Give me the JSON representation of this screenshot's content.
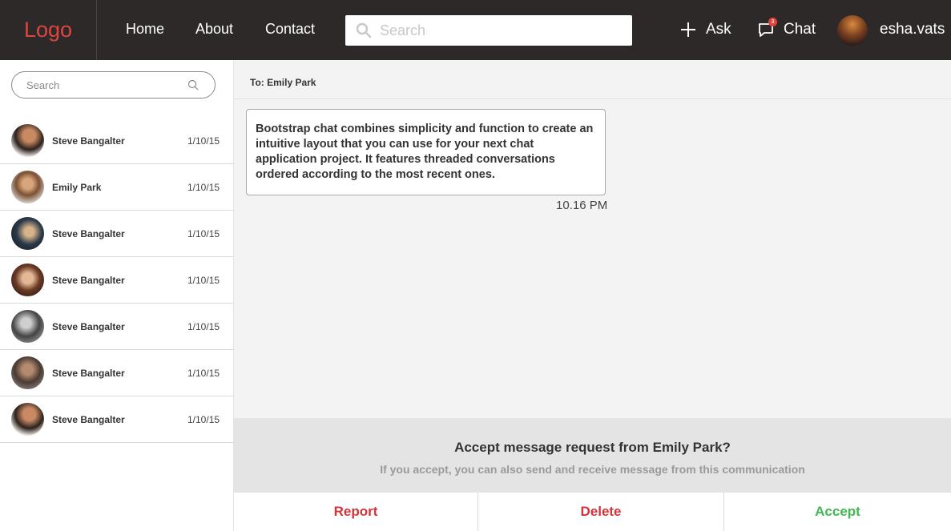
{
  "nav": {
    "logo": "Logo",
    "links": [
      "Home",
      "About",
      "Contact"
    ],
    "search_placeholder": "Search",
    "ask_label": "Ask",
    "chat_label": "Chat",
    "chat_badge": "3",
    "username": "esha.vats",
    "accent_color": "#e0443f"
  },
  "sidebar": {
    "search_placeholder": "Search",
    "contacts": [
      {
        "name": "Steve Bangalter",
        "date": "1/10/15"
      },
      {
        "name": "Emily Park",
        "date": "1/10/15"
      },
      {
        "name": "Steve Bangalter",
        "date": "1/10/15"
      },
      {
        "name": "Steve Bangalter",
        "date": "1/10/15"
      },
      {
        "name": "Steve Bangalter",
        "date": "1/10/15"
      },
      {
        "name": "Steve Bangalter",
        "date": "1/10/15"
      },
      {
        "name": "Steve Bangalter",
        "date": "1/10/15"
      }
    ]
  },
  "conversation": {
    "to_label": "To: Emily Park",
    "message": "Bootstrap chat combines simplicity and function to create an intuitive layout that you can use for your next chat application project. It features threaded conversations ordered according to the most recent ones.",
    "time": "10.16 PM"
  },
  "request": {
    "question": "Accept message request from Emily Park?",
    "subtext": "If you accept, you can also send and receive message from this communication"
  },
  "actions": {
    "report": "Report",
    "delete": "Delete",
    "accept": "Accept",
    "report_color": "#d2333b",
    "delete_color": "#d2333b",
    "accept_color": "#3fb950"
  }
}
